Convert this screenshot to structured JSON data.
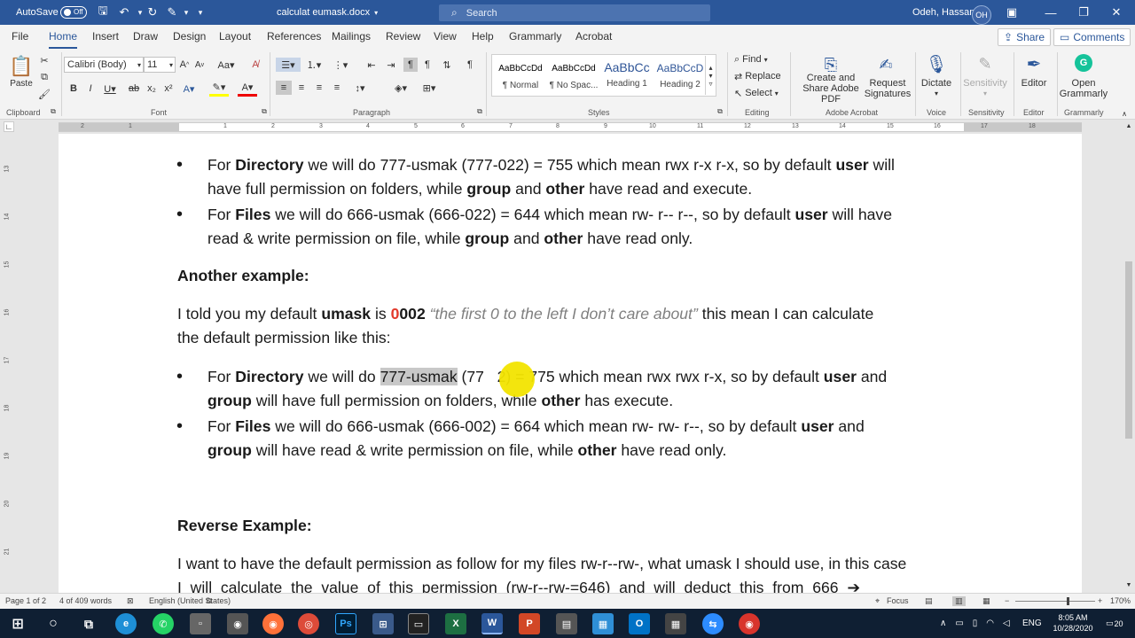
{
  "titlebar": {
    "autosave_label": "AutoSave",
    "autosave_state": "Off",
    "doc_title": "calculat eumask.docx",
    "search_placeholder": "Search",
    "user_name": "Odeh, Hassan",
    "user_initials": "OH"
  },
  "tabs": [
    "File",
    "Home",
    "Insert",
    "Draw",
    "Design",
    "Layout",
    "References",
    "Mailings",
    "Review",
    "View",
    "Help",
    "Grammarly",
    "Acrobat"
  ],
  "share_label": "Share",
  "comments_label": "Comments",
  "ribbon": {
    "clipboard": {
      "paste": "Paste",
      "group": "Clipboard"
    },
    "font": {
      "family": "Calibri (Body)",
      "size": "11",
      "group": "Font"
    },
    "paragraph": {
      "group": "Paragraph"
    },
    "styles": {
      "group": "Styles",
      "items": [
        {
          "preview": "AaBbCcDd",
          "name": "¶ Normal"
        },
        {
          "preview": "AaBbCcDd",
          "name": "¶ No Spac..."
        },
        {
          "preview": "AaBbCc",
          "name": "Heading 1"
        },
        {
          "preview": "AaBbCcD",
          "name": "Heading 2"
        }
      ]
    },
    "editing": {
      "find": "Find",
      "replace": "Replace",
      "select": "Select",
      "group": "Editing"
    },
    "acrobat": {
      "create_share": "Create and Share Adobe PDF",
      "request_sig": "Request Signatures",
      "group": "Adobe Acrobat"
    },
    "voice": {
      "dictate": "Dictate",
      "group": "Voice"
    },
    "sensitivity": {
      "label": "Sensitivity",
      "group": "Sensitivity"
    },
    "editor": {
      "label": "Editor",
      "group": "Editor"
    },
    "grammarly": {
      "label": "Open Grammarly",
      "group": "Grammarly"
    }
  },
  "ruler_ticks": [
    "2",
    "1",
    "1",
    "2",
    "3",
    "4",
    "5",
    "6",
    "7",
    "8",
    "9",
    "10",
    "11",
    "12",
    "13",
    "14",
    "15",
    "16",
    "17",
    "18"
  ],
  "vruler_ticks": [
    "13",
    "14",
    "15",
    "16",
    "17",
    "18",
    "19",
    "20",
    "21"
  ],
  "document": {
    "b1_l1": [
      "For ",
      "Directory",
      " we will do 777-usmak (777-022) = 755 which mean rwx r-x r-x, so by default ",
      "user",
      " will"
    ],
    "b1_l2": [
      "have full permission on folders, while ",
      "group",
      " and ",
      "other",
      " have read and execute."
    ],
    "b2_l1": [
      " For ",
      "Files",
      " we will do 666-usmak (666-022) = 644 which mean rw- r-- r--, so by default ",
      "user",
      " will have"
    ],
    "b2_l2": [
      "read & write permission on file, while ",
      "group",
      " and ",
      "other",
      " have read only."
    ],
    "heading_another": "Another example:",
    "p1_l1": [
      "I told you my default ",
      "umask",
      " is ",
      "0",
      "002",
      " “the first 0 to the left I don’t care about”",
      " this mean I can calculate"
    ],
    "p1_l2": "the default permission like this:",
    "b3_l1": [
      "For ",
      "Directory",
      " we will do ",
      "777-usmak",
      " (77",
      "   ",
      "2) = 775 which mean rwx rwx r-x, so by default ",
      "user",
      " and"
    ],
    "b3_l2": [
      "group",
      " will have full permission on folders, while ",
      "other",
      " has execute."
    ],
    "b4_l1": [
      " For ",
      "Files",
      " we will do 666-usmak (666-002) = 664 which mean rw- rw- r--, so by default ",
      "user",
      " and"
    ],
    "b4_l2": [
      "group",
      " will have read & write permission on file, while ",
      "other",
      " have read only."
    ],
    "heading_reverse": "Reverse Example:",
    "p2_l1": "I want to have the default permission as follow for my files rw-r--rw-, what umask I should use, in this case",
    "p2_l2": "I  will  calculate  the  value  of  this  permission  (rw-r--rw-=646)  and  will  deduct  this  from  666  ➔"
  },
  "statusbar": {
    "page": "Page 1 of 2",
    "words": "4 of 409 words",
    "language": "English (United States)",
    "focus": "Focus",
    "zoom": "170%"
  },
  "taskbar": {
    "lang": "ENG",
    "time": "8:05 AM",
    "date": "10/28/2020",
    "notif": "20"
  }
}
